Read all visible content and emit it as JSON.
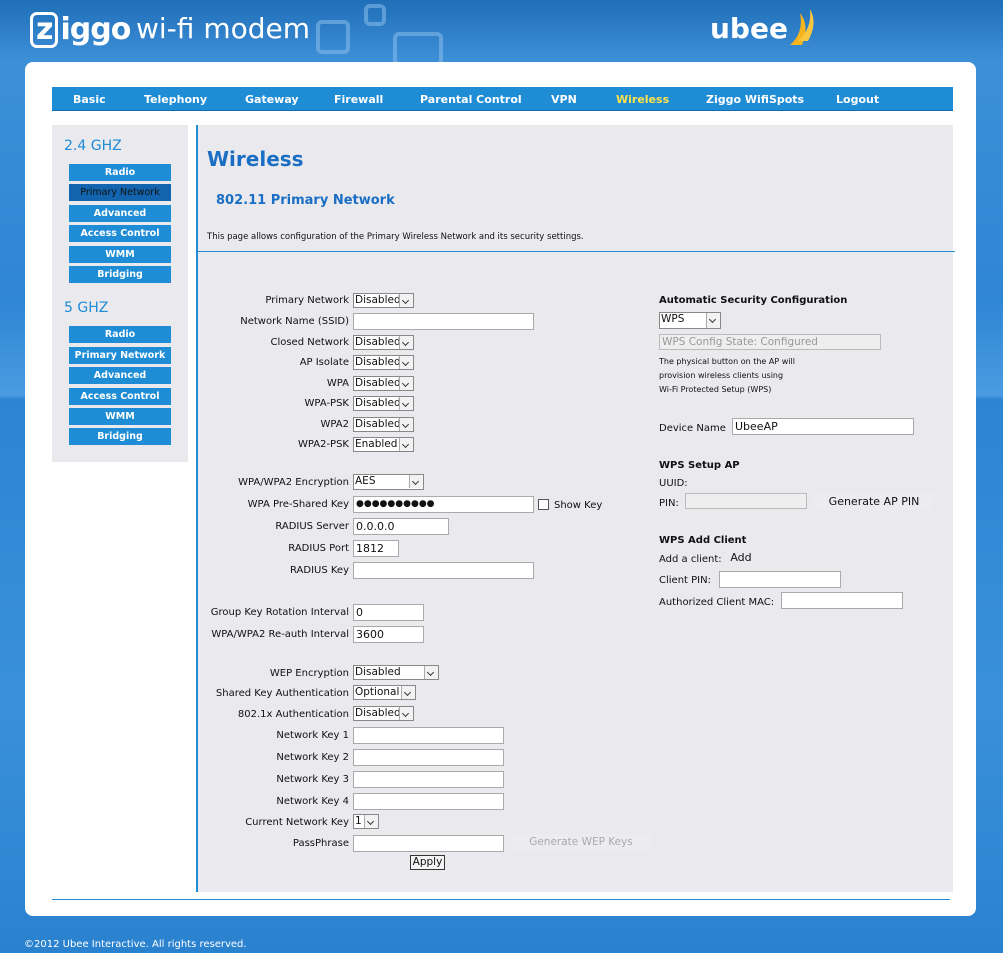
{
  "header": {
    "brand_z": "z",
    "brand_rest": "iggo",
    "product": "wi-fi modem",
    "vendor": "ubee"
  },
  "nav": [
    "Basic",
    "Telephony",
    "Gateway",
    "Firewall",
    "Parental Control",
    "VPN",
    "Wireless",
    "Ziggo WifiSpots",
    "Logout"
  ],
  "nav_active": "Wireless",
  "sidebar": {
    "band1": "2.4 GHZ",
    "band1_items": [
      "Radio",
      "Primary Network",
      "Advanced",
      "Access Control",
      "WMM",
      "Bridging"
    ],
    "band2": "5 GHZ",
    "band2_items": [
      "Radio",
      "Primary Network",
      "Advanced",
      "Access Control",
      "WMM",
      "Bridging"
    ]
  },
  "page": {
    "title": "Wireless",
    "subtitle": "802.11 Primary Network",
    "description": "This page allows configuration of the Primary Wireless Network and its security settings."
  },
  "form": {
    "primary_network": {
      "label": "Primary Network",
      "value": "Disabled"
    },
    "ssid": {
      "label": "Network Name (SSID)",
      "value": ""
    },
    "closed_network": {
      "label": "Closed Network",
      "value": "Disabled"
    },
    "ap_isolate": {
      "label": "AP Isolate",
      "value": "Disabled"
    },
    "wpa": {
      "label": "WPA",
      "value": "Disabled"
    },
    "wpa_psk": {
      "label": "WPA-PSK",
      "value": "Disabled"
    },
    "wpa2": {
      "label": "WPA2",
      "value": "Disabled"
    },
    "wpa2_psk": {
      "label": "WPA2-PSK",
      "value": "Enabled"
    },
    "encryption": {
      "label": "WPA/WPA2 Encryption",
      "value": "AES"
    },
    "psk": {
      "label": "WPA Pre-Shared Key",
      "value": "●●●●●●●●●●"
    },
    "show_key": {
      "label": "Show Key",
      "checked": false
    },
    "radius_server": {
      "label": "RADIUS Server",
      "value": "0.0.0.0"
    },
    "radius_port": {
      "label": "RADIUS Port",
      "value": "1812"
    },
    "radius_key": {
      "label": "RADIUS Key",
      "value": ""
    },
    "group_key": {
      "label": "Group Key Rotation Interval",
      "value": "0"
    },
    "reauth": {
      "label": "WPA/WPA2 Re-auth Interval",
      "value": "3600"
    },
    "wep_encryption": {
      "label": "WEP Encryption",
      "value": "Disabled"
    },
    "shared_key_auth": {
      "label": "Shared Key Authentication",
      "value": "Optional"
    },
    "auth_8021x": {
      "label": "802.1x Authentication",
      "value": "Disabled"
    },
    "network_key1": {
      "label": "Network Key 1",
      "value": ""
    },
    "network_key2": {
      "label": "Network Key 2",
      "value": ""
    },
    "network_key3": {
      "label": "Network Key 3",
      "value": ""
    },
    "network_key4": {
      "label": "Network Key 4",
      "value": ""
    },
    "current_key": {
      "label": "Current Network Key",
      "value": "1"
    },
    "passphrase": {
      "label": "PassPhrase",
      "value": ""
    },
    "generate_wep": "Generate WEP Keys",
    "apply": "Apply"
  },
  "wps": {
    "heading": "Automatic Security Configuration",
    "mode": "WPS",
    "state": "WPS Config State: Configured",
    "note_line1": "The physical button on the AP will",
    "note_line2": "provision wireless clients using",
    "note_line3": "Wi-Fi Protected Setup (WPS)",
    "device_name_label": "Device Name",
    "device_name": "UbeeAP",
    "setup_ap_heading": "WPS Setup AP",
    "uuid_label": "UUID:",
    "pin_label": "PIN:",
    "pin_value": "",
    "generate_pin": "Generate AP PIN",
    "add_client_heading": "WPS Add Client",
    "add_client_label": "Add a client:",
    "add_button": "Add",
    "client_pin_label": "Client PIN:",
    "client_pin": "",
    "client_mac_label": "Authorized Client MAC:",
    "client_mac": ""
  },
  "footer": {
    "copyright": "©2012 Ubee Interactive. All rights reserved."
  },
  "colors": {
    "accent": "#1f8cd6",
    "active_nav": "#ffe34a",
    "title": "#1a6fc4",
    "panel": "#e9e9ee"
  }
}
